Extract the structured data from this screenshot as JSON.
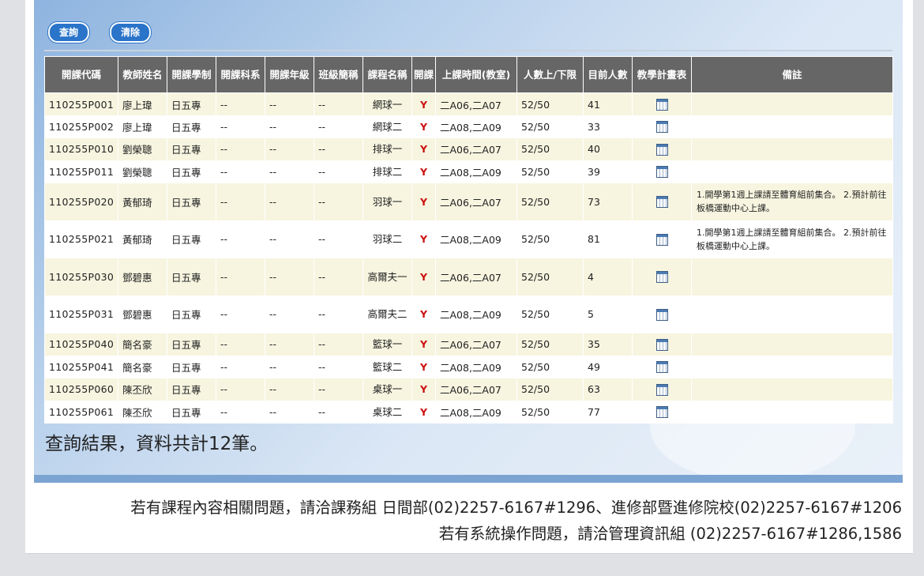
{
  "buttons": {
    "query": "查詢",
    "clear": "清除"
  },
  "headers": [
    "開課代碼",
    "教師姓名",
    "開課學制",
    "開課科系",
    "開課年級",
    "班級簡稱",
    "課程名稱",
    "開課",
    "上課時間(教室)",
    "人數上/下限",
    "目前人數",
    "教學計畫表",
    "備註"
  ],
  "rows": [
    {
      "code": "110255P001",
      "teacher": "廖上瑋",
      "system": "日五專",
      "dept": "--",
      "grade": "--",
      "cls": "--",
      "course": "網球一",
      "open": "Y",
      "time": "二A06,二A07",
      "limit": "52/50",
      "count": "41",
      "note": ""
    },
    {
      "code": "110255P002",
      "teacher": "廖上瑋",
      "system": "日五專",
      "dept": "--",
      "grade": "--",
      "cls": "--",
      "course": "網球二",
      "open": "Y",
      "time": "二A08,二A09",
      "limit": "52/50",
      "count": "33",
      "note": ""
    },
    {
      "code": "110255P010",
      "teacher": "劉榮聰",
      "system": "日五專",
      "dept": "--",
      "grade": "--",
      "cls": "--",
      "course": "排球一",
      "open": "Y",
      "time": "二A06,二A07",
      "limit": "52/50",
      "count": "40",
      "note": ""
    },
    {
      "code": "110255P011",
      "teacher": "劉榮聰",
      "system": "日五專",
      "dept": "--",
      "grade": "--",
      "cls": "--",
      "course": "排球二",
      "open": "Y",
      "time": "二A08,二A09",
      "limit": "52/50",
      "count": "39",
      "note": ""
    },
    {
      "code": "110255P020",
      "teacher": "黃郁琦",
      "system": "日五專",
      "dept": "--",
      "grade": "--",
      "cls": "--",
      "course": "羽球一",
      "open": "Y",
      "time": "二A06,二A07",
      "limit": "52/50",
      "count": "73",
      "note": "1.開學第1週上課請至體育組前集合。 2.預計前往板橋運動中心上課。"
    },
    {
      "code": "110255P021",
      "teacher": "黃郁琦",
      "system": "日五專",
      "dept": "--",
      "grade": "--",
      "cls": "--",
      "course": "羽球二",
      "open": "Y",
      "time": "二A08,二A09",
      "limit": "52/50",
      "count": "81",
      "note": "1.開學第1週上課請至體育組前集合。 2.預計前往板橋運動中心上課。"
    },
    {
      "code": "110255P030",
      "teacher": "鄧碧惠",
      "system": "日五專",
      "dept": "--",
      "grade": "--",
      "cls": "--",
      "course": "高爾夫一",
      "open": "Y",
      "time": "二A06,二A07",
      "limit": "52/50",
      "count": "4",
      "note": ""
    },
    {
      "code": "110255P031",
      "teacher": "鄧碧惠",
      "system": "日五專",
      "dept": "--",
      "grade": "--",
      "cls": "--",
      "course": "高爾夫二",
      "open": "Y",
      "time": "二A08,二A09",
      "limit": "52/50",
      "count": "5",
      "note": ""
    },
    {
      "code": "110255P040",
      "teacher": "簡名豪",
      "system": "日五專",
      "dept": "--",
      "grade": "--",
      "cls": "--",
      "course": "籃球一",
      "open": "Y",
      "time": "二A06,二A07",
      "limit": "52/50",
      "count": "35",
      "note": ""
    },
    {
      "code": "110255P041",
      "teacher": "簡名豪",
      "system": "日五專",
      "dept": "--",
      "grade": "--",
      "cls": "--",
      "course": "籃球二",
      "open": "Y",
      "time": "二A08,二A09",
      "limit": "52/50",
      "count": "49",
      "note": ""
    },
    {
      "code": "110255P060",
      "teacher": "陳丕欣",
      "system": "日五專",
      "dept": "--",
      "grade": "--",
      "cls": "--",
      "course": "桌球一",
      "open": "Y",
      "time": "二A06,二A07",
      "limit": "52/50",
      "count": "63",
      "note": ""
    },
    {
      "code": "110255P061",
      "teacher": "陳丕欣",
      "system": "日五專",
      "dept": "--",
      "grade": "--",
      "cls": "--",
      "course": "桌球二",
      "open": "Y",
      "time": "二A08,二A09",
      "limit": "52/50",
      "count": "77",
      "note": ""
    }
  ],
  "result_text": "查詢結果，資料共計12筆。",
  "footer": {
    "line1": "若有課程內容相關問題，請洽課務組 日間部(02)2257-6167#1296、進修部暨進修院校(02)2257-6167#1206",
    "line2": "若有系統操作問題，請洽管理資訊組 (02)2257-6167#1286,1586"
  },
  "icons": {
    "plan": "calendar-icon"
  },
  "colors": {
    "header_bg": "#666666",
    "row_alt": "#f7f5e0",
    "button": "#2a74c9",
    "open_mark": "#cc1111"
  }
}
